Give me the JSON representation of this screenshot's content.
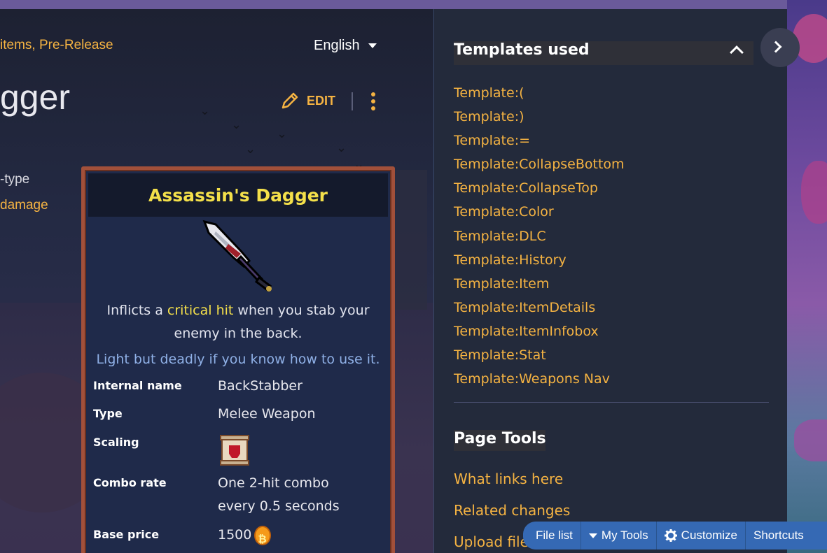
{
  "breadcrumb": "items, Pre-Release",
  "language": {
    "label": "English"
  },
  "page_title_fragment": "gger",
  "actions": {
    "edit_label": "EDIT"
  },
  "body_fragments": {
    "line1": "-type",
    "line2": "damage"
  },
  "infobox": {
    "title": "Assassin's Dagger",
    "description_pre": "Inflicts a ",
    "description_highlight": "critical hit",
    "description_post": " when you stab your enemy in the back.",
    "flavor": "Light but deadly if you know how to use it.",
    "rows": {
      "internal_name": {
        "label": "Internal name",
        "value": "BackStabber"
      },
      "type": {
        "label": "Type",
        "value": "Melee Weapon"
      },
      "scaling": {
        "label": "Scaling",
        "icon": "brutality-scroll-icon"
      },
      "combo_rate": {
        "label": "Combo rate",
        "value_line1": "One 2-hit combo",
        "value_line2": "every 0.5 seconds"
      },
      "base_price": {
        "label": "Base price",
        "value": "1500",
        "icon": "gold-coin-icon"
      }
    }
  },
  "sidebar": {
    "templates_title": "Templates used",
    "templates": [
      "Template:(",
      "Template:)",
      "Template:=",
      "Template:CollapseBottom",
      "Template:CollapseTop",
      "Template:Color",
      "Template:DLC",
      "Template:History",
      "Template:Item",
      "Template:ItemDetails",
      "Template:ItemInfobox",
      "Template:Stat",
      "Template:Weapons Nav"
    ],
    "page_tools_title": "Page Tools",
    "page_tools": [
      "What links here",
      "Related changes",
      "Upload file"
    ]
  },
  "toolbar": {
    "file_list": "File list",
    "my_tools": "My Tools",
    "customize": "Customize",
    "shortcuts": "Shortcuts"
  },
  "colors": {
    "accent": "#f5b342",
    "title_yellow": "#f4e04a",
    "toolbar_blue": "#3569b4",
    "infobox_border": "#a2503a"
  }
}
